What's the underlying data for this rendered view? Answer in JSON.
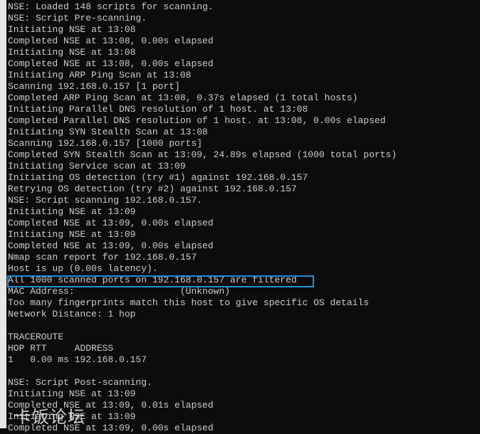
{
  "terminal": {
    "lines": [
      "NSE: Loaded 148 scripts for scanning.",
      "NSE: Script Pre-scanning.",
      "Initiating NSE at 13:08",
      "Completed NSE at 13:08, 0.00s elapsed",
      "Initiating NSE at 13:08",
      "Completed NSE at 13:08, 0.00s elapsed",
      "Initiating ARP Ping Scan at 13:08",
      "Scanning 192.168.0.157 [1 port]",
      "Completed ARP Ping Scan at 13:08, 0.37s elapsed (1 total hosts)",
      "Initiating Parallel DNS resolution of 1 host. at 13:08",
      "Completed Parallel DNS resolution of 1 host. at 13:08, 0.00s elapsed",
      "Initiating SYN Stealth Scan at 13:08",
      "Scanning 192.168.0.157 [1000 ports]",
      "Completed SYN Stealth Scan at 13:09, 24.89s elapsed (1000 total ports)",
      "Initiating Service scan at 13:09",
      "Initiating OS detection (try #1) against 192.168.0.157",
      "Retrying OS detection (try #2) against 192.168.0.157",
      "NSE: Script scanning 192.168.0.157.",
      "Initiating NSE at 13:09",
      "Completed NSE at 13:09, 0.00s elapsed",
      "Initiating NSE at 13:09",
      "Completed NSE at 13:09, 0.00s elapsed",
      "Nmap scan report for 192.168.0.157",
      "Host is up (0.00s latency).",
      "All 1000 scanned ports on 192.168.0.157 are filtered",
      "MAC Address:                   (Unknown)",
      "Too many fingerprints match this host to give specific OS details",
      "Network Distance: 1 hop",
      "",
      "TRACEROUTE",
      "HOP RTT     ADDRESS",
      "1   0.00 ms 192.168.0.157",
      "",
      "NSE: Script Post-scanning.",
      "Initiating NSE at 13:09",
      "Completed NSE at 13:09, 0.01s elapsed",
      "Initiating NSE at 13:09",
      "Completed NSE at 13:09, 0.00s elapsed"
    ]
  },
  "highlight_color": "#1e8fd6",
  "watermark": "卡饭论坛"
}
